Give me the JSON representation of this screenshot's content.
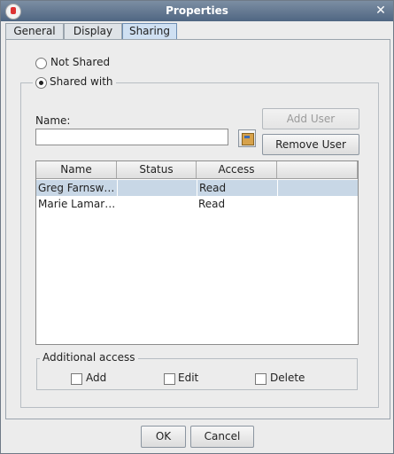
{
  "window": {
    "title": "Properties"
  },
  "tabs": [
    {
      "label": "General",
      "active": false
    },
    {
      "label": "Display",
      "active": false
    },
    {
      "label": "Sharing",
      "active": true
    }
  ],
  "sharing": {
    "not_shared_label": "Not Shared",
    "shared_with_label": "Shared with",
    "selected_option": "Shared with",
    "name_label": "Name:",
    "name_value": "",
    "add_user_label": "Add User",
    "remove_user_label": "Remove User",
    "table": {
      "columns": [
        "Name",
        "Status",
        "Access",
        ""
      ],
      "rows": [
        {
          "name": "Greg Farnsw…",
          "status": "",
          "access": "Read",
          "selected": true
        },
        {
          "name": "Marie Lamar…",
          "status": "",
          "access": "Read",
          "selected": false
        }
      ]
    },
    "additional_access": {
      "label": "Additional access",
      "options": [
        {
          "label": "Add",
          "checked": false
        },
        {
          "label": "Edit",
          "checked": false
        },
        {
          "label": "Delete",
          "checked": false
        }
      ]
    }
  },
  "footer": {
    "ok_label": "OK",
    "cancel_label": "Cancel"
  },
  "colors": {
    "titlebar": "#5b7190",
    "selection": "#c8d7e6",
    "active_tab": "#cfe0f2"
  }
}
